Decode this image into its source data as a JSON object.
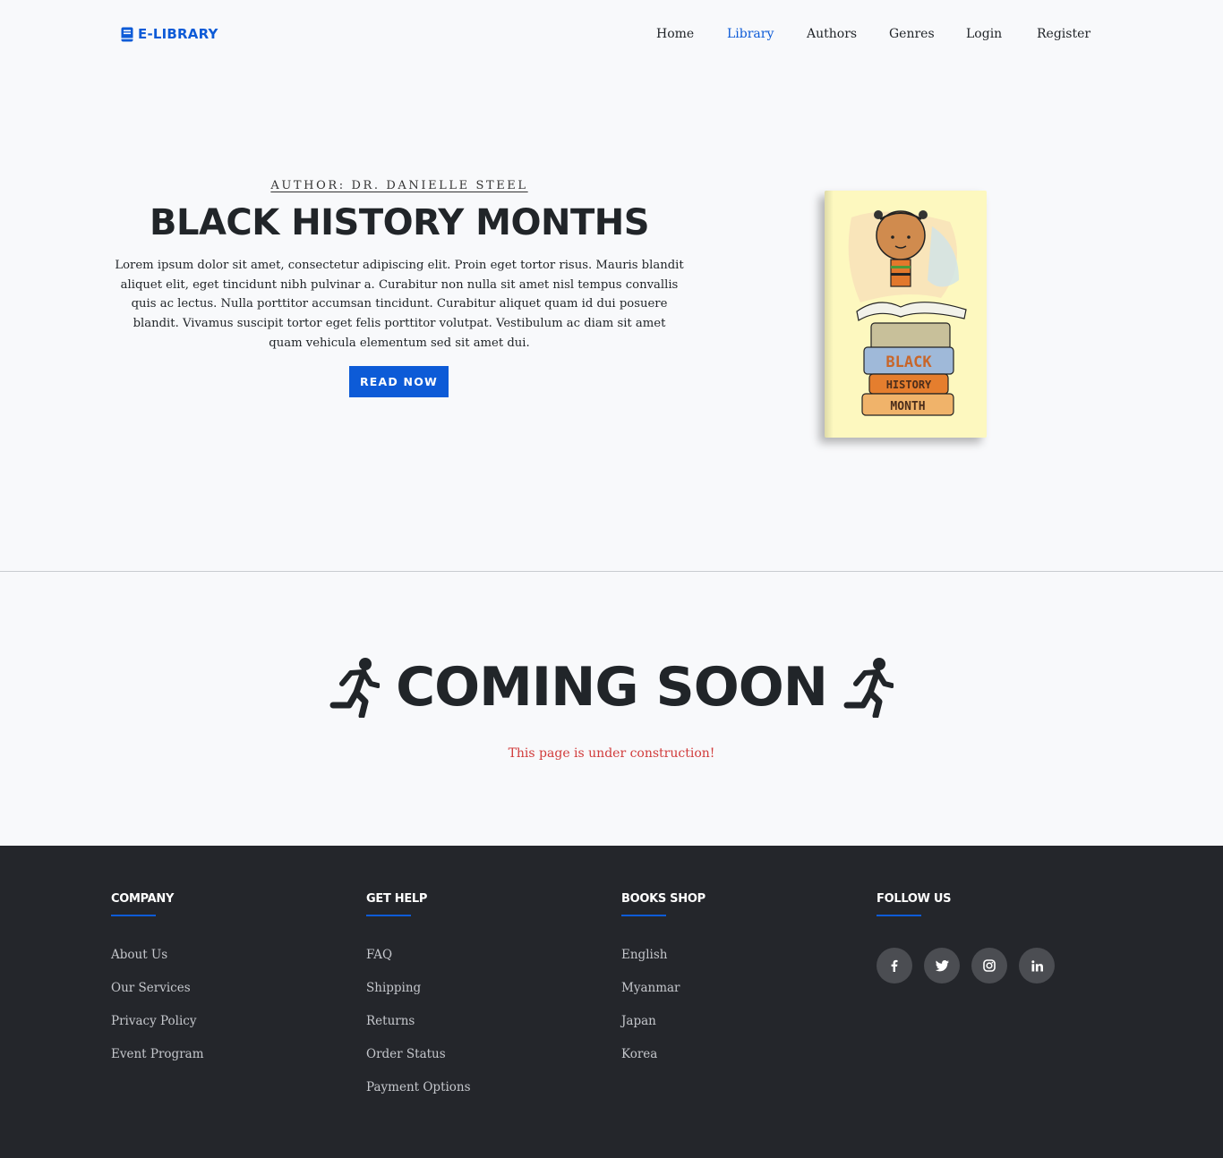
{
  "header": {
    "brand": "E-LIBRARY",
    "nav": [
      "Home",
      "Library",
      "Authors",
      "Genres",
      "Login",
      "Register"
    ],
    "active_nav": "Library"
  },
  "hero": {
    "author": "AUTHOR: DR. DANIELLE STEEL",
    "title": "BLACK HISTORY MONTHS",
    "description": "Lorem ipsum dolor sit amet, consectetur adipiscing elit. Proin eget tortor risus. Mauris blandit aliquet elit, eget tincidunt nibh pulvinar a. Curabitur non nulla sit amet nisl tempus convallis quis ac lectus. Nulla porttitor accumsan tincidunt. Curabitur aliquet quam id dui posuere blandit. Vivamus suscipit tortor eget felis porttitor volutpat. Vestibulum ac diam sit amet quam vehicula elementum sed sit amet dui.",
    "button": "READ NOW",
    "cover_words": [
      "BLACK",
      "HISTORY",
      "MONTH"
    ]
  },
  "coming_soon": {
    "title": "COMING SOON",
    "subtitle": "This page is under construction!",
    "icon": "running-person-icon"
  },
  "footer": {
    "company": {
      "title": "COMPANY",
      "links": [
        "About Us",
        "Our Services",
        "Privacy Policy",
        "Event Program"
      ]
    },
    "help": {
      "title": "GET HELP",
      "links": [
        "FAQ",
        "Shipping",
        "Returns",
        "Order Status",
        "Payment Options"
      ]
    },
    "shop": {
      "title": "BOOKS SHOP",
      "links": [
        "English",
        "Myanmar",
        "Japan",
        "Korea"
      ]
    },
    "follow": {
      "title": "FOLLOW US",
      "icons": [
        "facebook-icon",
        "twitter-icon",
        "instagram-icon",
        "linkedin-icon"
      ]
    }
  },
  "colors": {
    "accent": "#0d5bd7",
    "footer_bg": "#24262b",
    "warning_text": "#d13b3b",
    "page_bg": "#f8f9fb"
  }
}
